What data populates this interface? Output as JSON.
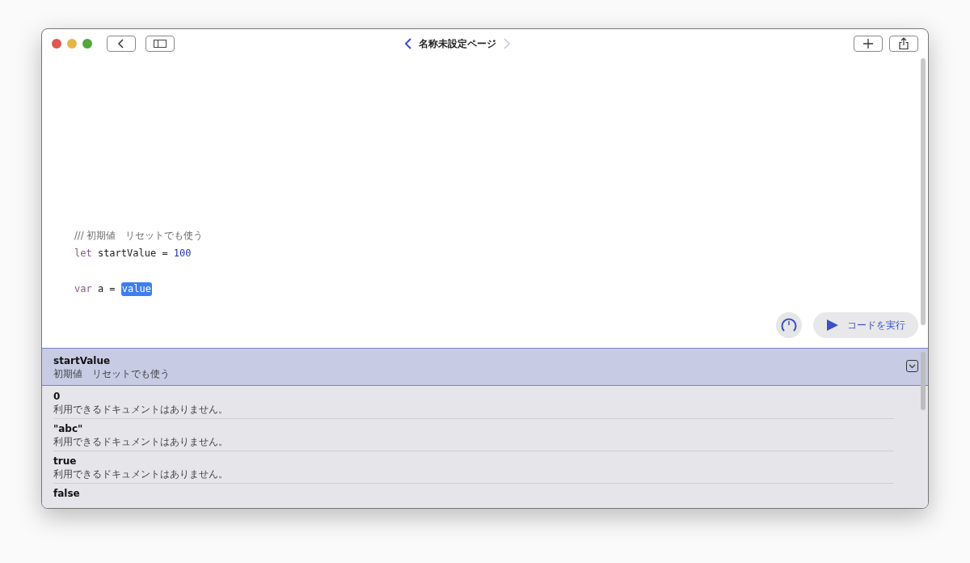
{
  "window": {
    "title": "名称未設定ページ",
    "back_enabled": true,
    "forward_enabled": false
  },
  "editor": {
    "lines": [
      {
        "kind": "code",
        "tokens": [
          {
            "text": "/// 初期値　リセットでも使う",
            "kind": "comment"
          }
        ]
      },
      {
        "kind": "code",
        "tokens": [
          {
            "text": "let",
            "kind": "keyword"
          },
          {
            "text": " startValue = ",
            "kind": "plain"
          },
          {
            "text": "100",
            "kind": "number"
          }
        ]
      },
      {
        "kind": "blank"
      },
      {
        "kind": "code",
        "tokens": [
          {
            "text": "var",
            "kind": "keyword"
          },
          {
            "text": " a = ",
            "kind": "plain"
          },
          {
            "text": "value",
            "kind": "placeholder"
          }
        ]
      }
    ],
    "run_button": "コードを実行"
  },
  "completions": [
    {
      "name": "startValue",
      "doc": "初期値　リセットでも使う",
      "selected": true
    },
    {
      "name": "0",
      "doc": "利用できるドキュメントはありません。",
      "selected": false
    },
    {
      "name": "\"abc\"",
      "doc": "利用できるドキュメントはありません。",
      "selected": false
    },
    {
      "name": "true",
      "doc": "利用できるドキュメントはありません。",
      "selected": false
    },
    {
      "name": "false",
      "selected": false
    }
  ]
}
